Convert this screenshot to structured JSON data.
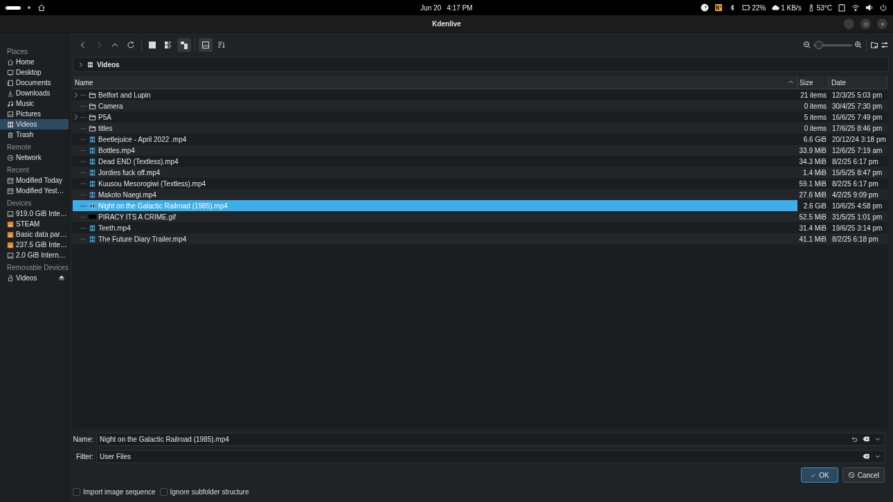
{
  "status_bar": {
    "date": "Jun 20",
    "time": "4:17 PM",
    "battery": "22%",
    "network_speed": "1 KB/s",
    "temperature": "53°C"
  },
  "window": {
    "title": "Kdenlive"
  },
  "sidebar": {
    "sections": [
      {
        "title": "Places",
        "items": [
          {
            "label": "Home",
            "kind": "home",
            "selected": false
          },
          {
            "label": "Desktop",
            "kind": "desktop",
            "selected": false
          },
          {
            "label": "Documents",
            "kind": "documents",
            "selected": false
          },
          {
            "label": "Downloads",
            "kind": "downloads",
            "selected": false
          },
          {
            "label": "Music",
            "kind": "music",
            "selected": false
          },
          {
            "label": "Pictures",
            "kind": "pictures",
            "selected": false
          },
          {
            "label": "Videos",
            "kind": "videos",
            "selected": true
          },
          {
            "label": "Trash",
            "kind": "trash",
            "selected": false
          }
        ]
      },
      {
        "title": "Remote",
        "items": [
          {
            "label": "Network",
            "kind": "network",
            "selected": false
          }
        ]
      },
      {
        "title": "Recent",
        "items": [
          {
            "label": "Modified Today",
            "kind": "calendar",
            "selected": false
          },
          {
            "label": "Modified Yest…",
            "kind": "calendar",
            "selected": false
          }
        ]
      },
      {
        "title": "Devices",
        "items": [
          {
            "label": "919.0 GiB Inte…",
            "kind": "disk",
            "selected": false
          },
          {
            "label": "STEAM",
            "kind": "partition",
            "selected": false
          },
          {
            "label": "Basic data par…",
            "kind": "partition",
            "selected": false
          },
          {
            "label": "237.5 GiB Inte…",
            "kind": "partition",
            "selected": false
          },
          {
            "label": "2.0 GiB Intern…",
            "kind": "disk",
            "selected": false
          }
        ]
      },
      {
        "title": "Removable Devices",
        "items": [
          {
            "label": "Videos",
            "kind": "removable",
            "selected": false
          }
        ]
      }
    ]
  },
  "toolbar": [
    {
      "kind": "back",
      "selected": false,
      "disabled": false
    },
    {
      "kind": "forward",
      "selected": false,
      "disabled": true
    },
    {
      "kind": "up",
      "selected": false,
      "disabled": false
    },
    {
      "kind": "reload",
      "selected": false,
      "disabled": false
    },
    {
      "kind": "icons",
      "selected": false,
      "disabled": false
    },
    {
      "kind": "compact",
      "selected": false,
      "disabled": false
    },
    {
      "kind": "tree",
      "selected": true,
      "disabled": false
    },
    {
      "kind": "preview",
      "selected": true,
      "disabled": false
    },
    {
      "kind": "sort",
      "selected": false,
      "disabled": false
    }
  ],
  "zoom": {
    "level": 0.05
  },
  "location": {
    "path": "Videos"
  },
  "table": {
    "columns": [
      {
        "label": "Name",
        "sorted": true
      },
      {
        "label": "Size",
        "sorted": false
      },
      {
        "label": "Date",
        "sorted": false
      }
    ],
    "rows": [
      {
        "name": "Belfort and Lupin",
        "kind": "folder",
        "expandable": true,
        "size": "21 items",
        "date": "12/3/25 5:03 pm",
        "selected": false
      },
      {
        "name": "Camera",
        "kind": "folder",
        "expandable": false,
        "size": "0 items",
        "date": "30/4/25 7:30 pm",
        "selected": false
      },
      {
        "name": "P5A",
        "kind": "folder",
        "expandable": true,
        "size": "5 items",
        "date": "16/6/25 7:49 pm",
        "selected": false
      },
      {
        "name": "titles",
        "kind": "folder",
        "expandable": false,
        "size": "0 items",
        "date": "17/6/25 8:46 pm",
        "selected": false
      },
      {
        "name": "Beetlejuice - April 2022 .mp4",
        "kind": "video",
        "expandable": false,
        "size": "6.6 GiB",
        "date": "20/12/24 3:18 pm",
        "selected": false
      },
      {
        "name": "Bottles.mp4",
        "kind": "video",
        "expandable": false,
        "size": "33.9 MiB",
        "date": "12/6/25 7:19 am",
        "selected": false
      },
      {
        "name": "Dead END (Textless).mp4",
        "kind": "video",
        "expandable": false,
        "size": "34.3 MiB",
        "date": "8/2/25 6:17 pm",
        "selected": false
      },
      {
        "name": "Jordies fuck off.mp4",
        "kind": "video",
        "expandable": false,
        "size": "1.4 MiB",
        "date": "15/5/25 8:47 pm",
        "selected": false
      },
      {
        "name": "Kuusou Mesorogiwi (Textless).mp4",
        "kind": "video",
        "expandable": false,
        "size": "59.1 MiB",
        "date": "8/2/25 6:17 pm",
        "selected": false
      },
      {
        "name": "Makoto Naegi.mp4",
        "kind": "video",
        "expandable": false,
        "size": "27.6 MiB",
        "date": "4/2/25 9:09 pm",
        "selected": false
      },
      {
        "name": "Night on the Galactic Railroad (1985).mp4",
        "kind": "video",
        "expandable": false,
        "size": "2.6 GiB",
        "date": "10/6/25 4:58 pm",
        "selected": true
      },
      {
        "name": "PIRACY ITS A CRIME.gif",
        "kind": "image",
        "expandable": false,
        "size": "52.5 MiB",
        "date": "31/5/25 1:01 pm",
        "selected": false
      },
      {
        "name": "Teeth.mp4",
        "kind": "video",
        "expandable": false,
        "size": "31.4 MiB",
        "date": "19/6/25 3:14 pm",
        "selected": false
      },
      {
        "name": "The Future Diary Trailer.mp4",
        "kind": "video",
        "expandable": false,
        "size": "41.1 MiB",
        "date": "8/2/25 6:18 pm",
        "selected": false
      }
    ]
  },
  "name_field": {
    "label": "Name:",
    "value": "Night on the Galactic Railroad (1985).mp4"
  },
  "filter_field": {
    "label": "Filter:",
    "value": "User Files"
  },
  "buttons": [
    {
      "label": "OK",
      "kind": "ok",
      "focused": true
    },
    {
      "label": "Cancel",
      "kind": "cancel",
      "focused": false
    }
  ],
  "options": [
    {
      "label": "Import image sequence",
      "checked": false
    },
    {
      "label": "Ignore subfolder structure",
      "checked": false
    }
  ]
}
